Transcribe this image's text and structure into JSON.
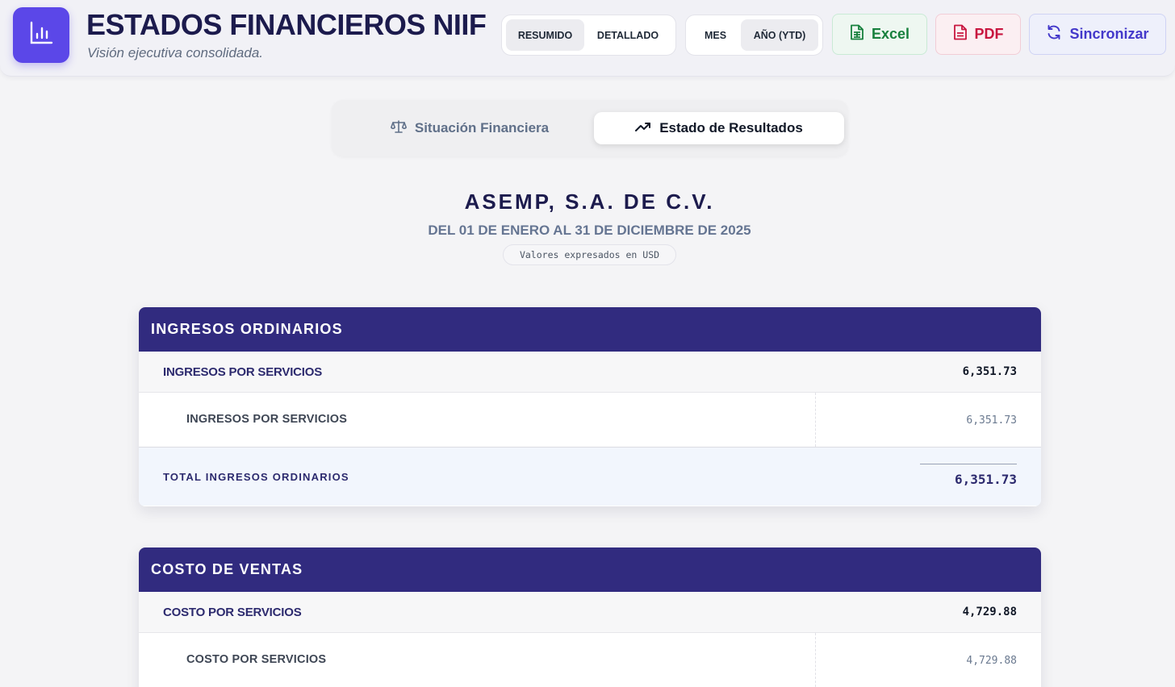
{
  "header": {
    "title": "ESTADOS FINANCIEROS NIIF",
    "subtitle": "Visión ejecutiva consolidada.",
    "view_toggle": {
      "summary": "RESUMIDO",
      "detailed": "DETALLADO",
      "active": "summary"
    },
    "period_toggle": {
      "month": "MES",
      "ytd": "AÑO (YTD)",
      "active": "ytd"
    },
    "actions": {
      "excel": "Excel",
      "pdf": "PDF",
      "sync": "Sincronizar"
    },
    "icons": {
      "logo": "bar-chart-icon",
      "excel": "spreadsheet-file-icon",
      "pdf": "document-file-icon",
      "sync": "refresh-icon"
    }
  },
  "tabs": [
    {
      "label": "Situación Financiera",
      "icon": "scale-icon",
      "active": false
    },
    {
      "label": "Estado de Resultados",
      "icon": "trending-up-icon",
      "active": true
    }
  ],
  "report": {
    "company": "ASEMP, S.A. DE C.V.",
    "period": "DEL 01 DE ENERO AL 31 DE DICIEMBRE DE 2025",
    "currency_note": "Valores expresados en USD"
  },
  "sections": [
    {
      "title": "INGRESOS ORDINARIOS",
      "group": {
        "label": "INGRESOS POR SERVICIOS",
        "value": "6,351.73"
      },
      "detail": {
        "label": "INGRESOS POR SERVICIOS",
        "value": "6,351.73"
      },
      "total": {
        "label": "TOTAL INGRESOS ORDINARIOS",
        "value": "6,351.73"
      }
    },
    {
      "title": "COSTO DE VENTAS",
      "group": {
        "label": "COSTO POR SERVICIOS",
        "value": "4,729.88"
      },
      "detail": {
        "label": "COSTO POR SERVICIOS",
        "value": "4,729.88"
      }
    }
  ],
  "colors": {
    "brand": "#5b47e8",
    "section_header": "#312b7f",
    "excel": "#17803d",
    "pdf": "#c8163f",
    "sync": "#4338ca"
  }
}
